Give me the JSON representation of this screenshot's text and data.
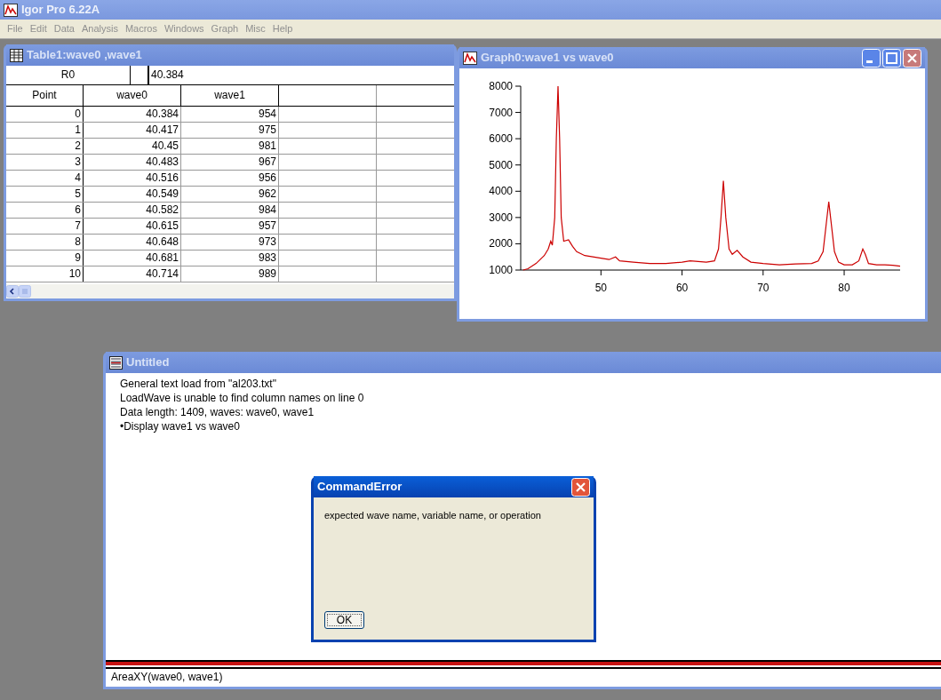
{
  "app": {
    "title": "Igor Pro 6.22A"
  },
  "menu": [
    "File",
    "Edit",
    "Data",
    "Analysis",
    "Macros",
    "Windows",
    "Graph",
    "Misc",
    "Help"
  ],
  "table_window": {
    "title": "Table1:wave0 ,wave1",
    "entry_label": "R0",
    "entry_value": "40.384",
    "columns": [
      "Point",
      "wave0",
      "wave1"
    ],
    "rows": [
      [
        "0",
        "40.384",
        "954"
      ],
      [
        "1",
        "40.417",
        "975"
      ],
      [
        "2",
        "40.45",
        "981"
      ],
      [
        "3",
        "40.483",
        "967"
      ],
      [
        "4",
        "40.516",
        "956"
      ],
      [
        "5",
        "40.549",
        "962"
      ],
      [
        "6",
        "40.582",
        "984"
      ],
      [
        "7",
        "40.615",
        "957"
      ],
      [
        "8",
        "40.648",
        "973"
      ],
      [
        "9",
        "40.681",
        "983"
      ],
      [
        "10",
        "40.714",
        "989"
      ]
    ]
  },
  "graph_window": {
    "title": "Graph0:wave1 vs wave0",
    "chart_data": {
      "type": "line",
      "xlim": [
        40.1,
        86.9
      ],
      "ylim": [
        1000,
        8000
      ],
      "xticks": [
        50,
        60,
        70,
        80
      ],
      "yticks": [
        1000,
        2000,
        3000,
        4000,
        5000,
        6000,
        7000,
        8000
      ],
      "x": [
        40.4,
        41,
        42,
        43,
        43.5,
        43.8,
        44,
        44.3,
        44.5,
        44.7,
        44.9,
        45.1,
        45.4,
        46,
        46.5,
        47,
        48,
        49,
        50,
        51,
        51.8,
        52.3,
        54,
        56,
        58,
        60,
        61,
        63,
        64,
        64.5,
        64.8,
        65.1,
        65.4,
        65.8,
        66.2,
        66.8,
        67.5,
        68.5,
        70,
        72,
        74,
        76,
        76.8,
        77.4,
        77.8,
        78.1,
        78.4,
        78.8,
        79.3,
        80,
        81,
        81.8,
        82.3,
        82.6,
        83,
        84,
        85,
        86,
        86.9
      ],
      "series": [
        {
          "color": "#cc0000",
          "values": [
            1000,
            1050,
            1250,
            1550,
            1800,
            2100,
            1950,
            3000,
            6000,
            8000,
            6000,
            3000,
            2100,
            2150,
            1900,
            1700,
            1550,
            1500,
            1450,
            1400,
            1500,
            1350,
            1300,
            1250,
            1250,
            1300,
            1350,
            1300,
            1350,
            1800,
            3000,
            4400,
            3000,
            1800,
            1600,
            1750,
            1500,
            1300,
            1250,
            1200,
            1230,
            1250,
            1350,
            1700,
            2800,
            3600,
            2800,
            1700,
            1300,
            1200,
            1200,
            1350,
            1800,
            1600,
            1250,
            1200,
            1200,
            1180,
            1150
          ]
        }
      ]
    }
  },
  "history_window": {
    "title": "Untitled",
    "lines": [
      "General text load from \"al203.txt\"",
      "LoadWave is unable to find column names on line 0",
      "Data length: 1409, waves: wave0, wave1",
      "•Display wave1 vs wave0"
    ],
    "command": "AreaXY(wave0, wave1)"
  },
  "dialog": {
    "title": "CommandError",
    "message": "expected wave name, variable name, or operation",
    "button": "OK"
  }
}
